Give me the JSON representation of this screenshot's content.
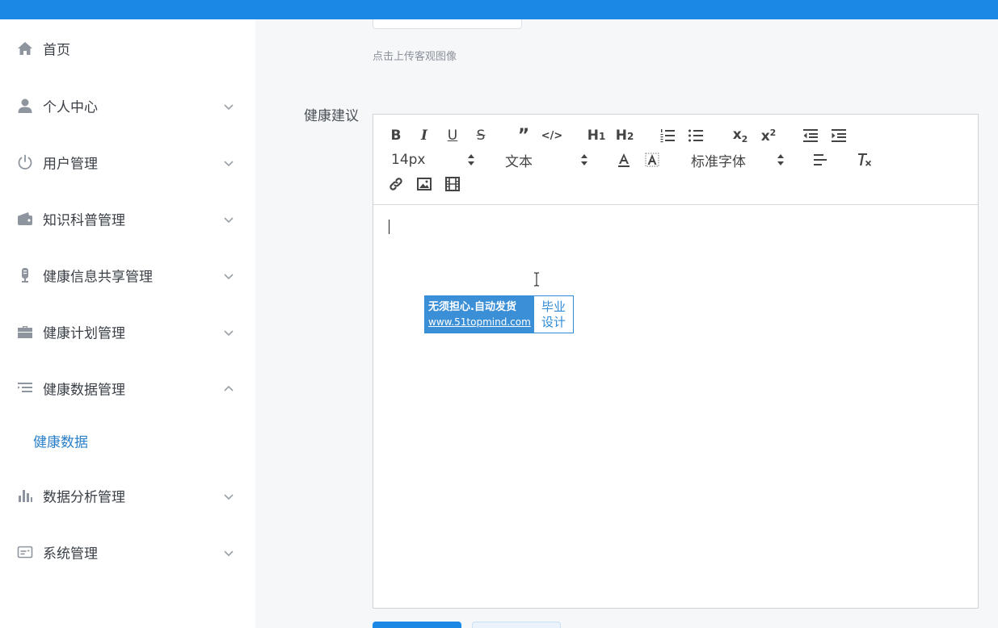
{
  "theme": {
    "accent": "#1c88e6",
    "active_submenu": "#2a7fc9"
  },
  "sidebar": {
    "items": [
      {
        "label": "首页",
        "icon": "home-icon",
        "expandable": false
      },
      {
        "label": "个人中心",
        "icon": "user-icon",
        "expandable": true
      },
      {
        "label": "用户管理",
        "icon": "power-icon",
        "expandable": true
      },
      {
        "label": "知识科普管理",
        "icon": "wallet-icon",
        "expandable": true
      },
      {
        "label": "健康信息共享管理",
        "icon": "microphone-icon",
        "expandable": true
      },
      {
        "label": "健康计划管理",
        "icon": "briefcase-icon",
        "expandable": true
      },
      {
        "label": "健康数据管理",
        "icon": "list-icon",
        "expandable": true,
        "expanded": true,
        "children": [
          {
            "label": "健康数据",
            "active": true
          }
        ]
      },
      {
        "label": "数据分析管理",
        "icon": "bar-chart-icon",
        "expandable": true
      },
      {
        "label": "系统管理",
        "icon": "id-card-icon",
        "expandable": true
      }
    ]
  },
  "form": {
    "upload_tip": "点击上传客观图像",
    "advice_label": "健康建议",
    "editor": {
      "font_size": "14px",
      "block_format": "文本",
      "font_family": "标准字体",
      "content": ""
    }
  },
  "watermark": {
    "line1": "无须担心.自动发货",
    "line2": "www.51topmind.com",
    "side1": "毕业",
    "side2": "设计"
  }
}
